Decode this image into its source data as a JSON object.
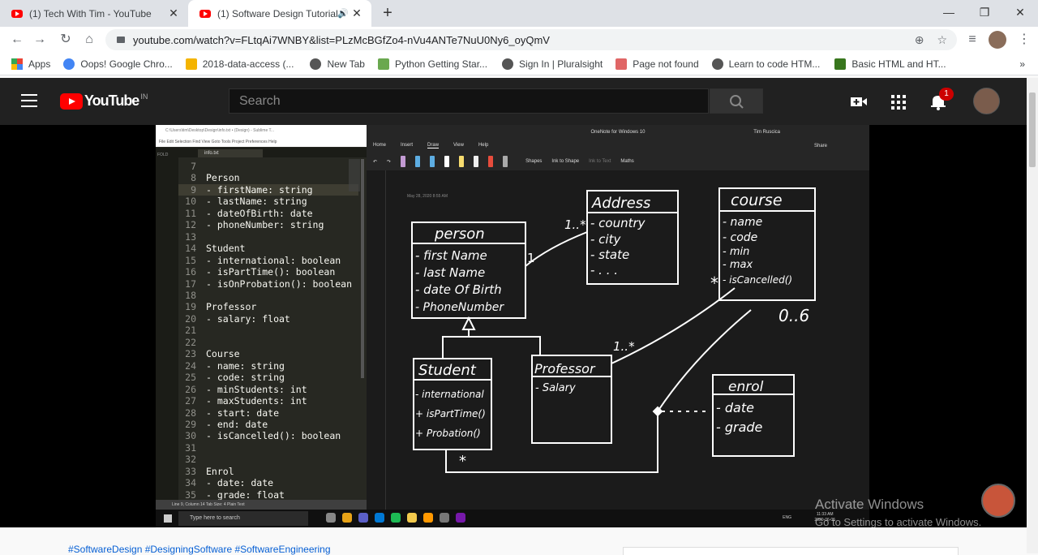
{
  "browser": {
    "tabs": [
      {
        "title": "(1) Tech With Tim - YouTube",
        "close": "✕"
      },
      {
        "title": "(1) Software Design Tutorial",
        "close": "✕",
        "active": true
      }
    ],
    "new_tab": "+",
    "window": {
      "minimize": "—",
      "maximize": "❐",
      "close": "✕"
    },
    "url": "youtube.com/watch?v=FLtqAi7WNBY&list=PLzMcBGfZo4-nVu4ANTe7NuU0Ny6_oyQmV",
    "nav": {
      "back": "←",
      "forward": "→",
      "reload": "↻",
      "home": "⌂"
    },
    "bookmarks": [
      {
        "label": "Apps",
        "color": "#ea4335"
      },
      {
        "label": "Oops! Google Chro...",
        "color": "#4285f4"
      },
      {
        "label": "2018-data-access (...",
        "color": "#f4b400"
      },
      {
        "label": "New Tab",
        "color": "#555555"
      },
      {
        "label": "Python Getting Star...",
        "color": "#6aa84f"
      },
      {
        "label": "Sign In | Pluralsight",
        "color": "#555555"
      },
      {
        "label": "Page not found",
        "color": "#e06666"
      },
      {
        "label": "Learn to code HTM...",
        "color": "#555555"
      },
      {
        "label": "Basic HTML and HT...",
        "color": "#38761d"
      }
    ],
    "more_bookmarks": "»"
  },
  "youtube": {
    "logo_text": "YouTube",
    "country": "IN",
    "search_placeholder": "Search",
    "notification_count": "1"
  },
  "video": {
    "sublime": {
      "title": "C:\\Users\\tim\\Desktop\\Design\\info.txt • (Design) - Sublime T...",
      "menu": "File  Edit  Selection  Find  View  Goto  Tools  Project  Preferences  Help",
      "sidebar_label": "FOLD",
      "file_tab": "info.txt",
      "status": "Line 9, Column 14                                             Tab Size: 4         Plain Text",
      "lines": [
        {
          "n": "7",
          "t": ""
        },
        {
          "n": "8",
          "t": "Person"
        },
        {
          "n": "9",
          "t": "- firstName: string"
        },
        {
          "n": "10",
          "t": "- lastName: string"
        },
        {
          "n": "11",
          "t": "- dateOfBirth: date"
        },
        {
          "n": "12",
          "t": "- phoneNumber: string"
        },
        {
          "n": "13",
          "t": ""
        },
        {
          "n": "14",
          "t": "Student"
        },
        {
          "n": "15",
          "t": "- international: boolean"
        },
        {
          "n": "16",
          "t": "- isPartTime(): boolean"
        },
        {
          "n": "17",
          "t": "- isOnProbation(): boolean"
        },
        {
          "n": "18",
          "t": ""
        },
        {
          "n": "19",
          "t": "Professor"
        },
        {
          "n": "20",
          "t": "- salary: float"
        },
        {
          "n": "21",
          "t": ""
        },
        {
          "n": "22",
          "t": ""
        },
        {
          "n": "23",
          "t": "Course"
        },
        {
          "n": "24",
          "t": "- name: string"
        },
        {
          "n": "25",
          "t": "- code: string"
        },
        {
          "n": "26",
          "t": "- minStudents: int"
        },
        {
          "n": "27",
          "t": "- maxStudents: int"
        },
        {
          "n": "28",
          "t": "- start: date"
        },
        {
          "n": "29",
          "t": "- end: date"
        },
        {
          "n": "30",
          "t": "- isCancelled(): boolean"
        },
        {
          "n": "31",
          "t": ""
        },
        {
          "n": "32",
          "t": ""
        },
        {
          "n": "33",
          "t": "Enrol"
        },
        {
          "n": "34",
          "t": "- date: date"
        },
        {
          "n": "35",
          "t": "- grade: float"
        }
      ]
    },
    "onenote": {
      "title": "OneNote for Windows 10",
      "user": "Tim Ruscica",
      "ribbon_tabs": [
        "Home",
        "Insert",
        "Draw",
        "View",
        "Help"
      ],
      "share": "Share",
      "shapes": "Shapes",
      "ink_to_shape": "Ink to Shape",
      "ink_to_text": "Ink to Text",
      "maths": "Maths",
      "page_date": "May 28, 2020     8:55 AM",
      "diagram": {
        "person": {
          "title": "person",
          "attrs": [
            "- first Name",
            "- last Name",
            "- date Of Birth",
            "- PhoneNumber"
          ]
        },
        "address": {
          "title": "Address",
          "attrs": [
            "- country",
            "- city",
            "- state",
            "- . . ."
          ]
        },
        "course": {
          "title": "course",
          "attrs": [
            "- name",
            "- code",
            "- min",
            "- max",
            "- isCancelled()"
          ]
        },
        "student": {
          "title": "Student",
          "attrs": [
            "- international",
            "+ isPartTime()",
            "+ Probation()"
          ]
        },
        "professor": {
          "title": "Professor",
          "attrs": [
            "- Salary"
          ]
        },
        "enrol": {
          "title": "enrol",
          "attrs": [
            "- date",
            "- grade"
          ]
        },
        "mult_person_address_left": "1",
        "mult_person_address_right": "1..*",
        "mult_prof_course": "1..*",
        "mult_course_star": "*",
        "mult_course_range": "0..6",
        "mult_student": "*"
      }
    },
    "taskbar": {
      "search": "Type here to search",
      "time": "11:33 AM",
      "date": "2020-06-05",
      "lang": "ENG"
    },
    "activate_title": "Activate Windows",
    "activate_sub": "Go to Settings to activate Windows."
  },
  "description": {
    "hashtags": "#SoftwareDesign #DesigningSoftware #SoftwareEngineering"
  }
}
